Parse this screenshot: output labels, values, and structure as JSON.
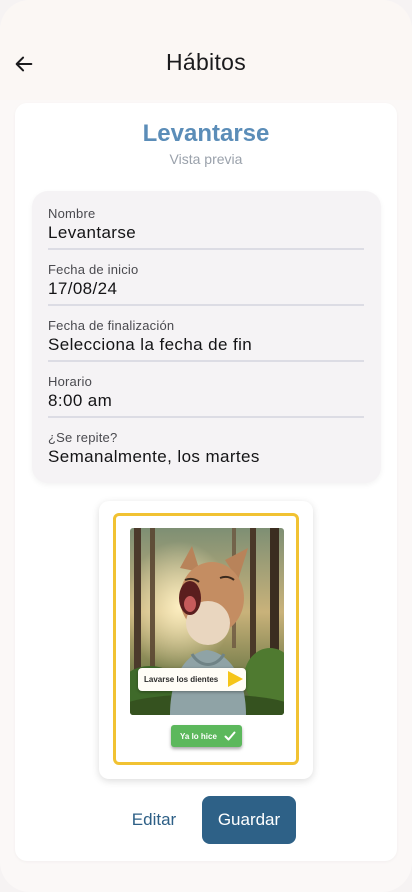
{
  "header": {
    "back_icon": "arrow-left-icon",
    "title": "Hábitos"
  },
  "habit": {
    "name": "Levantarse",
    "preview_label": "Vista previa"
  },
  "form": {
    "fields": [
      {
        "label": "Nombre",
        "value": "Levantarse"
      },
      {
        "label": "Fecha de inicio",
        "value": "17/08/24"
      },
      {
        "label": "Fecha de finalización",
        "value": "Selecciona la fecha de fin"
      },
      {
        "label": "Horario",
        "value": "8:00 am"
      },
      {
        "label": "¿Se repite?",
        "value": "Semanalmente, los martes"
      }
    ]
  },
  "preview_card": {
    "image_icon": "yawning-fox-illustration",
    "habit_pill_text": "Lavarse los dientes",
    "play_icon": "play-icon",
    "done_button_text": "Ya lo hice",
    "done_icon": "check-icon"
  },
  "actions": {
    "edit_label": "Editar",
    "save_label": "Guardar"
  },
  "colors": {
    "accent": "#2e6187",
    "title_blue": "#5b8db8",
    "frame_yellow": "#f1c232",
    "done_green": "#5cb85c",
    "play_yellow": "#f5c518"
  }
}
